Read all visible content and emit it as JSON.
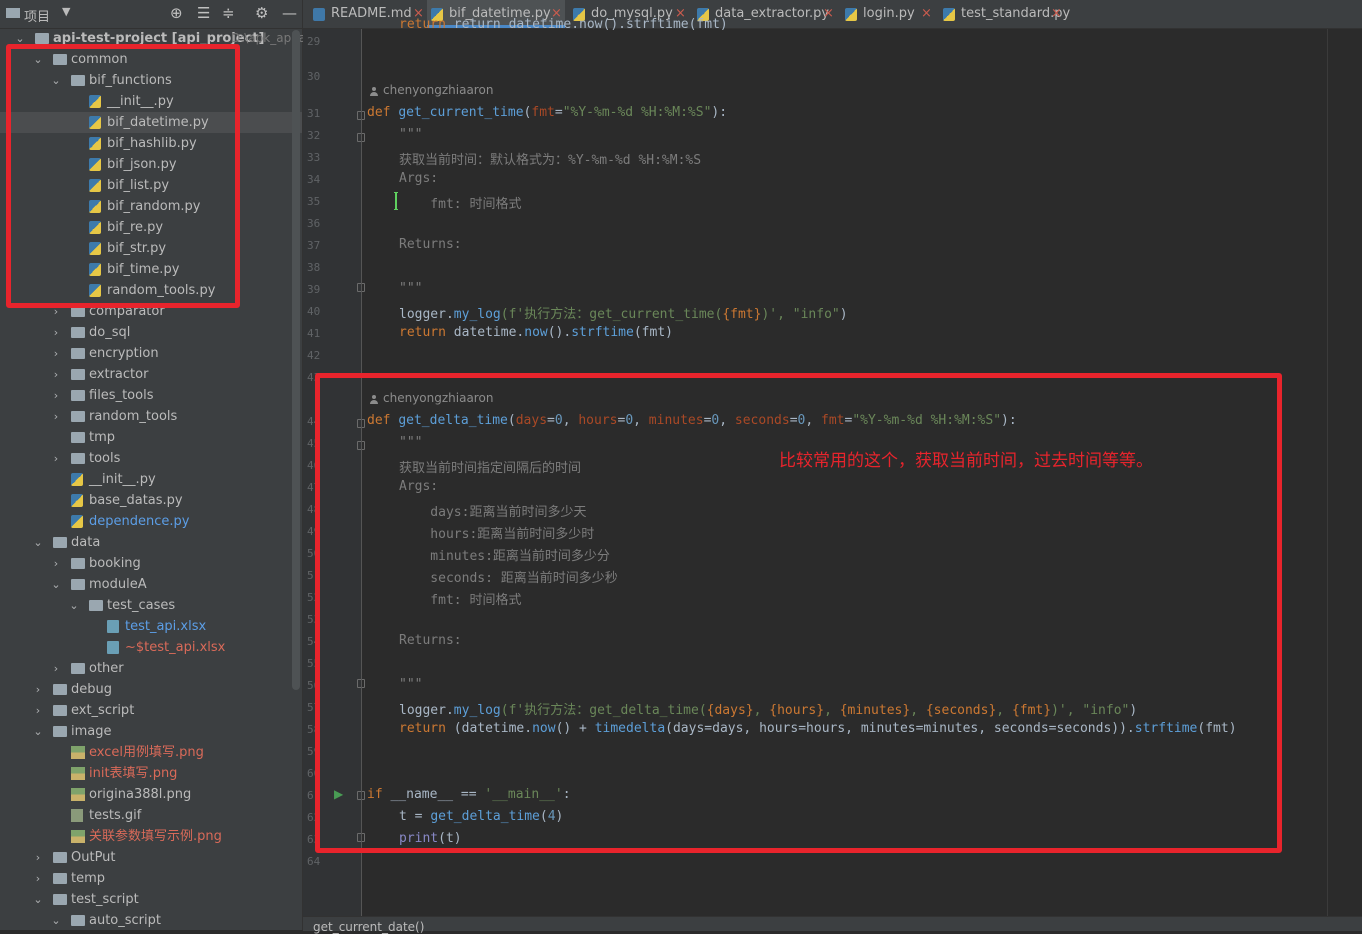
{
  "sidebar": {
    "title": "项目",
    "tree": [
      {
        "label": "api-test-project [api_project]",
        "suffix": "D:\\apk_api\\api-",
        "type": "folder",
        "level": 0,
        "arrow": "down",
        "bold": true
      },
      {
        "label": "common",
        "type": "folder",
        "level": 1,
        "arrow": "down"
      },
      {
        "label": "bif_functions",
        "type": "folder",
        "level": 2,
        "arrow": "down"
      },
      {
        "label": "__init__.py",
        "type": "py",
        "level": 3
      },
      {
        "label": "bif_datetime.py",
        "type": "py",
        "level": 3,
        "selected": true
      },
      {
        "label": "bif_hashlib.py",
        "type": "py",
        "level": 3
      },
      {
        "label": "bif_json.py",
        "type": "py",
        "level": 3
      },
      {
        "label": "bif_list.py",
        "type": "py",
        "level": 3
      },
      {
        "label": "bif_random.py",
        "type": "py",
        "level": 3
      },
      {
        "label": "bif_re.py",
        "type": "py",
        "level": 3
      },
      {
        "label": "bif_str.py",
        "type": "py",
        "level": 3
      },
      {
        "label": "bif_time.py",
        "type": "py",
        "level": 3
      },
      {
        "label": "random_tools.py",
        "type": "py",
        "level": 3
      },
      {
        "label": "comparator",
        "type": "folder",
        "level": 2,
        "arrow": "right"
      },
      {
        "label": "do_sql",
        "type": "folder",
        "level": 2,
        "arrow": "right"
      },
      {
        "label": "encryption",
        "type": "folder",
        "level": 2,
        "arrow": "right"
      },
      {
        "label": "extractor",
        "type": "folder",
        "level": 2,
        "arrow": "right"
      },
      {
        "label": "files_tools",
        "type": "folder",
        "level": 2,
        "arrow": "right"
      },
      {
        "label": "random_tools",
        "type": "folder",
        "level": 2,
        "arrow": "right"
      },
      {
        "label": "tmp",
        "type": "folder",
        "level": 2
      },
      {
        "label": "tools",
        "type": "folder",
        "level": 2,
        "arrow": "right"
      },
      {
        "label": "__init__.py",
        "type": "py",
        "level": 2
      },
      {
        "label": "base_datas.py",
        "type": "py",
        "level": 2
      },
      {
        "label": "dependence.py",
        "type": "py",
        "level": 2,
        "color": "blue"
      },
      {
        "label": "data",
        "type": "folder",
        "level": 1,
        "arrow": "down"
      },
      {
        "label": "booking",
        "type": "folder",
        "level": 2,
        "arrow": "right"
      },
      {
        "label": "moduleA",
        "type": "folder",
        "level": 2,
        "arrow": "down"
      },
      {
        "label": "test_cases",
        "type": "folder",
        "level": 3,
        "arrow": "down"
      },
      {
        "label": "test_api.xlsx",
        "type": "xls",
        "level": 4,
        "color": "blue"
      },
      {
        "label": "~$test_api.xlsx",
        "type": "xls",
        "level": 4,
        "color": "red"
      },
      {
        "label": "other",
        "type": "folder",
        "level": 2,
        "arrow": "right"
      },
      {
        "label": "debug",
        "type": "folder",
        "level": 1,
        "arrow": "right"
      },
      {
        "label": "ext_script",
        "type": "folder",
        "level": 1,
        "arrow": "right"
      },
      {
        "label": "image",
        "type": "folder",
        "level": 1,
        "arrow": "down"
      },
      {
        "label": "excel用例填写.png",
        "type": "img",
        "level": 2,
        "color": "red"
      },
      {
        "label": "init表填写.png",
        "type": "img",
        "level": 2,
        "color": "red"
      },
      {
        "label": "origina388l.png",
        "type": "img",
        "level": 2
      },
      {
        "label": "tests.gif",
        "type": "gif",
        "level": 2
      },
      {
        "label": "关联参数填写示例.png",
        "type": "img",
        "level": 2,
        "color": "red"
      },
      {
        "label": "OutPut",
        "type": "folder",
        "level": 1,
        "arrow": "right"
      },
      {
        "label": "temp",
        "type": "folder",
        "level": 1,
        "arrow": "right"
      },
      {
        "label": "test_script",
        "type": "folder",
        "level": 1,
        "arrow": "down"
      },
      {
        "label": "auto_script",
        "type": "folder",
        "level": 2,
        "arrow": "down"
      }
    ]
  },
  "tabs": [
    {
      "label": "README.md",
      "icon": "md"
    },
    {
      "label": "bif_datetime.py",
      "icon": "py",
      "active": true
    },
    {
      "label": "do_mysql.py",
      "icon": "py"
    },
    {
      "label": "data_extractor.py",
      "icon": "py"
    },
    {
      "label": "login.py",
      "icon": "py"
    },
    {
      "label": "test_standard.py",
      "icon": "py"
    }
  ],
  "editor": {
    "line_numbers": [
      "29",
      "30",
      "31",
      "32",
      "33",
      "34",
      "35",
      "36",
      "37",
      "38",
      "39",
      "40",
      "41",
      "42",
      "43",
      "44",
      "45",
      "46",
      "47",
      "48",
      "49",
      "50",
      "51",
      "52",
      "53",
      "54",
      "55",
      "56",
      "57",
      "58",
      "59",
      "60",
      "61",
      "62",
      "63",
      "64"
    ],
    "author": "chenyongzhiaaron",
    "code_lines": {
      "l28": "return datetime.now().strftime(fmt)",
      "l31_name": "get_current_time",
      "l31_fmt": "\"%Y-%m-%d %H:%M:%S\"",
      "l32": "\"\"\"",
      "l33": "获取当前时间：默认格式为：%Y-%m-%d %H:%M:%S",
      "l34": "Args:",
      "l35": "    fmt: 时间格式",
      "l37": "Returns:",
      "l39": "\"\"\"",
      "l40_a": "logger.",
      "l40_b": "my_log",
      "l40_c": "(f'执行方法：get_current_time(",
      "l40_d": "{fmt}",
      "l40_e": ")', ",
      "l40_f": "\"info\"",
      "l40_g": ")",
      "l41_a": "datetime.",
      "l41_b": "now",
      "l41_c": "().",
      "l41_d": "strftime",
      "l41_e": "(fmt)",
      "l44_name": "get_delta_time",
      "l44_fmt": "\"%Y-%m-%d %H:%M:%S\"",
      "l46": "获取当前时间指定间隔后的时间",
      "l47": "Args:",
      "l48": "    days:距离当前时间多少天",
      "l49": "    hours:距离当前时间多少时",
      "l50": "    minutes:距离当前时间多少分",
      "l51": "    seconds: 距离当前时间多少秒",
      "l52": "    fmt: 时间格式",
      "l54": "Returns:",
      "l56": "\"\"\"",
      "l57_c": "(f'执行方法：get_delta_time(",
      "l57_args": [
        "{days}",
        "{hours}",
        "{minutes}",
        "{seconds}",
        "{fmt}"
      ],
      "l58_b": "(datetime.",
      "l58_c": "now",
      "l58_d": "() + ",
      "l58_e": "timedelta",
      "l58_f": "(days=days, hours=hours, minutes=minutes, seconds=seconds)).",
      "l58_g": "strftime",
      "l58_h": "(fmt)",
      "l61_a": "__name__ == ",
      "l61_b": "'__main__'",
      "l61_c": ":",
      "l62_a": "t = ",
      "l62_b": "get_delta_time",
      "l62_c": "(",
      "l62_d": "4",
      "l62_e": ")",
      "l63_a": "print",
      "l63_b": "(t)"
    }
  },
  "annotation": "比较常用的这个，获取当前时间，过去时间等等。",
  "statusbar": "get_current_date()",
  "colors": {
    "highlight_box": "#e8242c",
    "accent": "#4a88c7"
  }
}
